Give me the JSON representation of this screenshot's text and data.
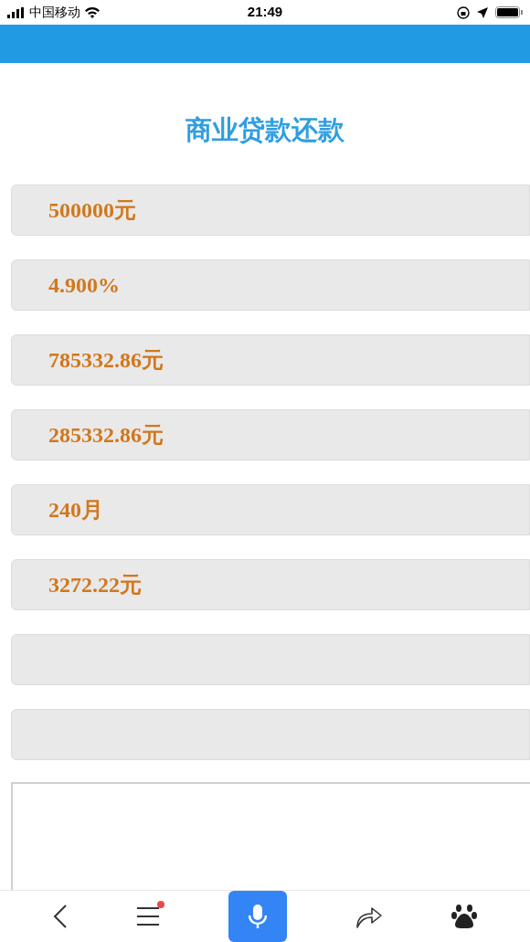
{
  "status_bar": {
    "carrier": "中国移动",
    "time": "21:49"
  },
  "title": "商业贷款还款",
  "fields": [
    {
      "kind": "value",
      "value": "500000元"
    },
    {
      "kind": "value",
      "value": "4.900%"
    },
    {
      "kind": "value",
      "value": "785332.86元"
    },
    {
      "kind": "value",
      "value": "285332.86元"
    },
    {
      "kind": "value",
      "value": "240月"
    },
    {
      "kind": "value",
      "value": "3272.22元"
    },
    {
      "kind": "empty"
    },
    {
      "kind": "empty"
    }
  ],
  "bottom_bar": {
    "menu_badge": true
  }
}
